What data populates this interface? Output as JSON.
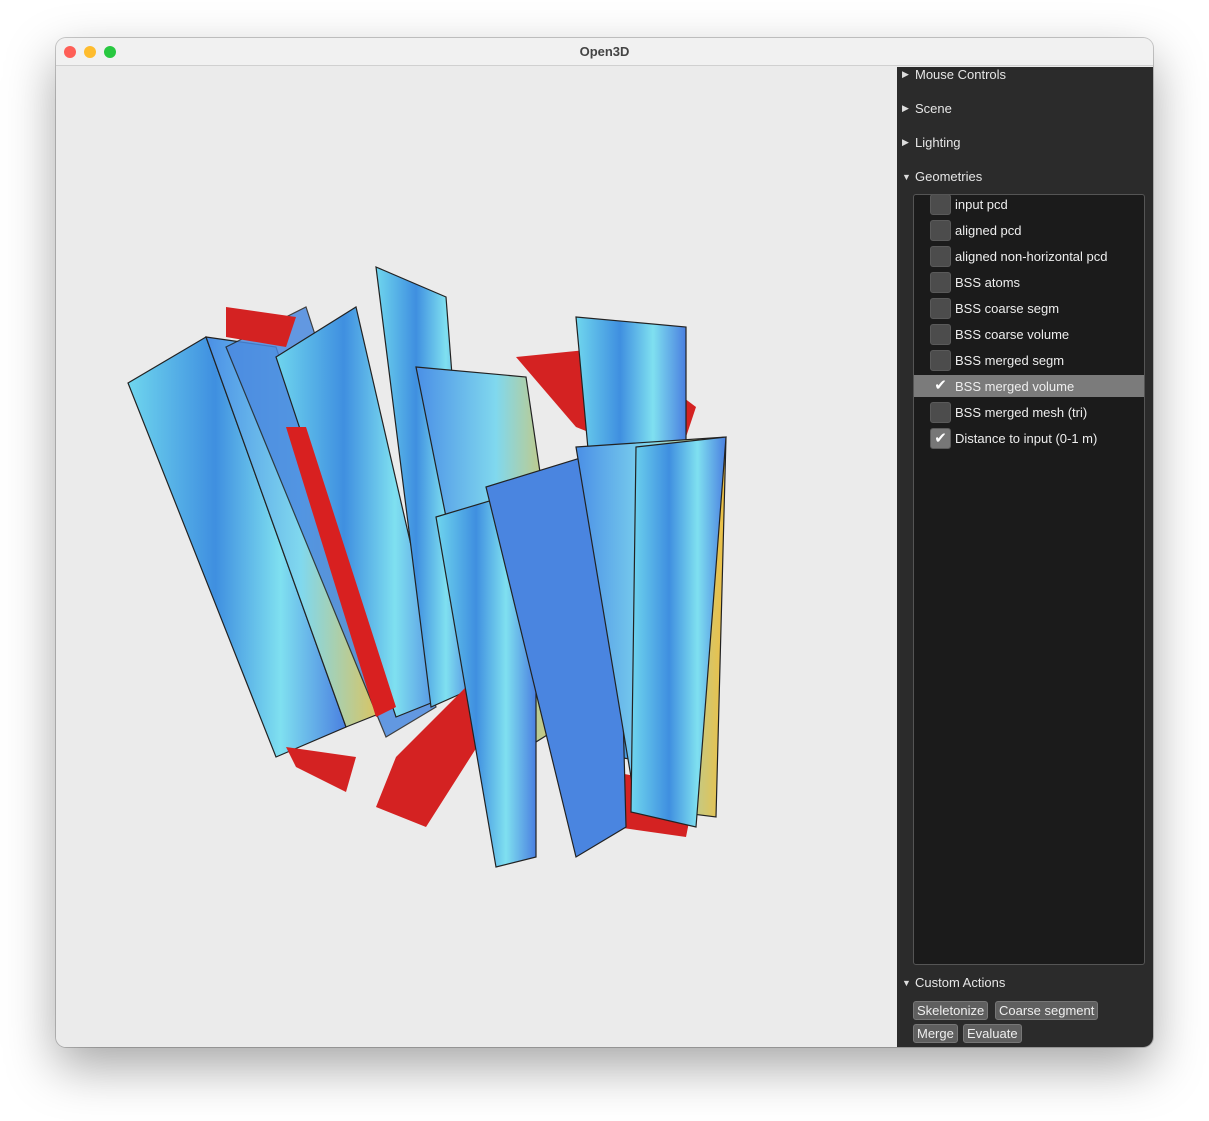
{
  "window": {
    "title": "Open3D"
  },
  "panel": {
    "sections": {
      "mouse_controls": "Mouse Controls",
      "scene": "Scene",
      "lighting": "Lighting",
      "geometries": "Geometries",
      "custom_actions": "Custom Actions"
    },
    "geometries": [
      {
        "label": "input pcd",
        "checked": false
      },
      {
        "label": "aligned pcd",
        "checked": false
      },
      {
        "label": "aligned non-horizontal pcd",
        "checked": false
      },
      {
        "label": "BSS atoms",
        "checked": false
      },
      {
        "label": "BSS coarse segm",
        "checked": false
      },
      {
        "label": "BSS coarse volume",
        "checked": false
      },
      {
        "label": "BSS merged segm",
        "checked": false
      },
      {
        "label": "BSS merged volume",
        "checked": true,
        "selected": true
      },
      {
        "label": "BSS merged mesh (tri)",
        "checked": false
      },
      {
        "label": "Distance to input (0-1 m)",
        "checked": true
      }
    ],
    "actions": {
      "skeletonize": "Skeletonize",
      "coarse_segment": "Coarse segment",
      "merge": "Merge",
      "evaluate": "Evaluate"
    }
  },
  "colors": {
    "viewport_bg": "#ebebeb",
    "panel_bg": "#2b2b2b",
    "near": "#1e5bd8",
    "mid": "#7fe0f0",
    "far": "#d81e1e"
  }
}
